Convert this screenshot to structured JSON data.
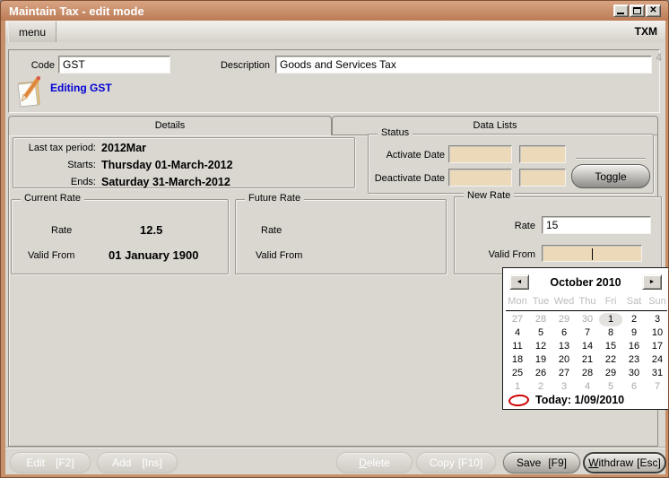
{
  "window": {
    "title": "Maintain Tax - edit mode",
    "app_badge": "TXM",
    "menu_label": "menu",
    "icons": {
      "close": "✕"
    }
  },
  "form": {
    "record_indicator": "4",
    "code_label": "Code",
    "code_value": "GST",
    "description_label": "Description",
    "description_value": "Goods and Services Tax",
    "edit_status": "Editing GST"
  },
  "tabs": {
    "details": "Details",
    "data_lists": "Data Lists"
  },
  "period": {
    "rows": [
      {
        "label": "Last tax period:",
        "value": "2012Mar"
      },
      {
        "label": "Starts:",
        "value": "Thursday 01-March-2012"
      },
      {
        "label": "Ends:",
        "value": "Saturday 31-March-2012"
      }
    ]
  },
  "status": {
    "legend": "Status",
    "activate_label": "Activate Date",
    "deactivate_label": "Deactivate Date",
    "activate_values": [
      "",
      ""
    ],
    "deactivate_values": [
      "",
      ""
    ],
    "toggle_label": "Toggle"
  },
  "current_rate": {
    "legend": "Current Rate",
    "rate_label": "Rate",
    "rate_value": "12.5",
    "valid_from_label": "Valid From",
    "valid_from_value": "01 January 1900"
  },
  "future_rate": {
    "legend": "Future Rate",
    "rate_label": "Rate",
    "rate_value": "",
    "valid_from_label": "Valid From",
    "valid_from_value": ""
  },
  "new_rate": {
    "legend": "New Rate",
    "rate_label": "Rate",
    "rate_value": "15",
    "valid_from_label": "Valid From",
    "valid_from_value": ""
  },
  "calendar": {
    "month_title": "October 2010",
    "nav_left_icon": "◄",
    "nav_right_icon": "►",
    "weekdays": [
      "Mon",
      "Tue",
      "Wed",
      "Thu",
      "Fri",
      "Sat",
      "Sun"
    ],
    "days": [
      {
        "d": "27",
        "muted": true
      },
      {
        "d": "28",
        "muted": true
      },
      {
        "d": "29",
        "muted": true
      },
      {
        "d": "30",
        "muted": true
      },
      {
        "d": "1",
        "selected": true
      },
      {
        "d": "2"
      },
      {
        "d": "3"
      },
      {
        "d": "4"
      },
      {
        "d": "5"
      },
      {
        "d": "6"
      },
      {
        "d": "7"
      },
      {
        "d": "8"
      },
      {
        "d": "9"
      },
      {
        "d": "10"
      },
      {
        "d": "11"
      },
      {
        "d": "12"
      },
      {
        "d": "13"
      },
      {
        "d": "14"
      },
      {
        "d": "15"
      },
      {
        "d": "16"
      },
      {
        "d": "17"
      },
      {
        "d": "18"
      },
      {
        "d": "19"
      },
      {
        "d": "20"
      },
      {
        "d": "21"
      },
      {
        "d": "22"
      },
      {
        "d": "23"
      },
      {
        "d": "24"
      },
      {
        "d": "25"
      },
      {
        "d": "26"
      },
      {
        "d": "27"
      },
      {
        "d": "28"
      },
      {
        "d": "29"
      },
      {
        "d": "30"
      },
      {
        "d": "31"
      },
      {
        "d": "1",
        "muted": true
      },
      {
        "d": "2",
        "muted": true
      },
      {
        "d": "3",
        "muted": true
      },
      {
        "d": "4",
        "muted": true
      },
      {
        "d": "5",
        "muted": true
      },
      {
        "d": "6",
        "muted": true
      },
      {
        "d": "7",
        "muted": true
      }
    ],
    "today_label": "Today: 1/09/2010"
  },
  "actions": [
    {
      "label": "Edit",
      "key": "[F2]",
      "enabled": false
    },
    {
      "label": "Add",
      "key": "[Ins]",
      "enabled": false
    },
    {
      "label": "Delete",
      "key": "",
      "enabled": false
    },
    {
      "label": "Copy",
      "key": "[F10]",
      "enabled": false
    },
    {
      "label": "Save",
      "key": "[F9]",
      "enabled": true
    },
    {
      "label": "Withdraw",
      "key": "[Esc]",
      "enabled": true
    }
  ]
}
